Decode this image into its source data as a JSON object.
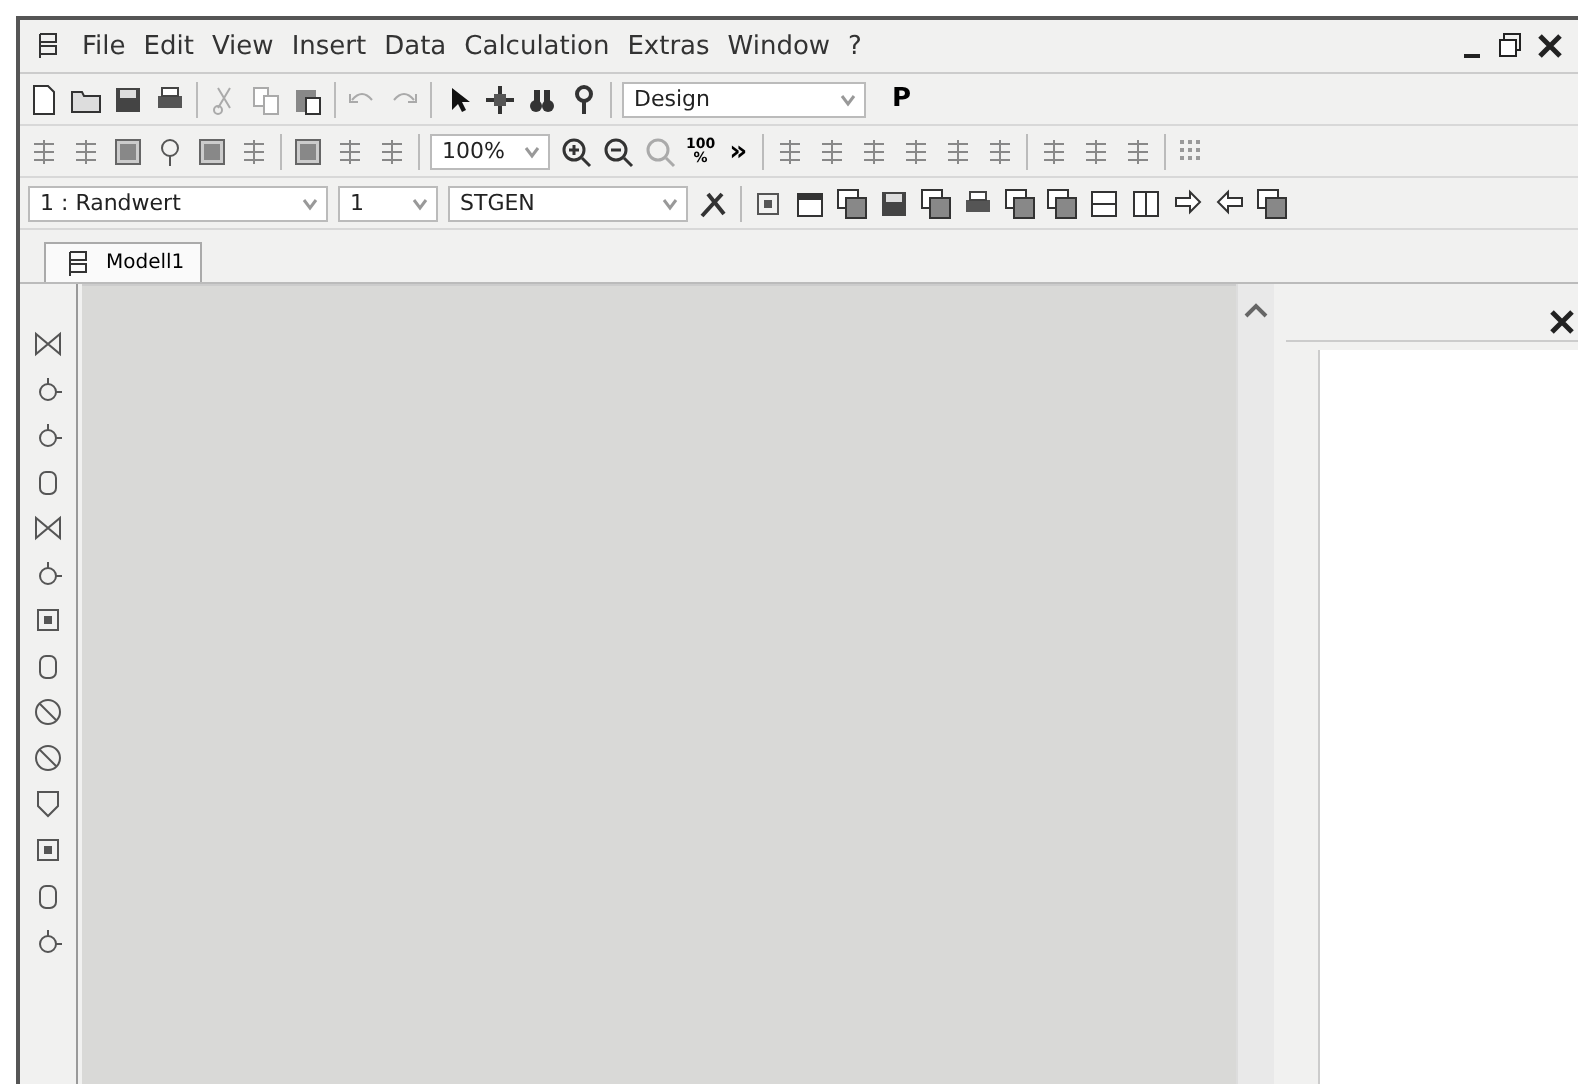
{
  "menu_bar": {
    "items": [
      {
        "label": "File"
      },
      {
        "label": "Edit"
      },
      {
        "label": "View"
      },
      {
        "label": "Insert"
      },
      {
        "label": "Data"
      },
      {
        "label": "Calculation"
      },
      {
        "label": "Extras"
      },
      {
        "label": "Window"
      },
      {
        "label": "?"
      }
    ]
  },
  "toolbar_1": {
    "mode_combo": {
      "value": "Design"
    },
    "p_button": "P"
  },
  "toolbar_2": {
    "zoom_combo": {
      "value": "100%"
    },
    "zoom_100_button": [
      "100",
      "%"
    ],
    "more_button": "»"
  },
  "toolbar_3": {
    "case_combo": {
      "value": "1 : Randwert"
    },
    "number_combo": {
      "value": "1"
    },
    "module_combo": {
      "value": "STGEN"
    }
  },
  "tabs": [
    {
      "label": "Modell1",
      "selected": true
    }
  ]
}
